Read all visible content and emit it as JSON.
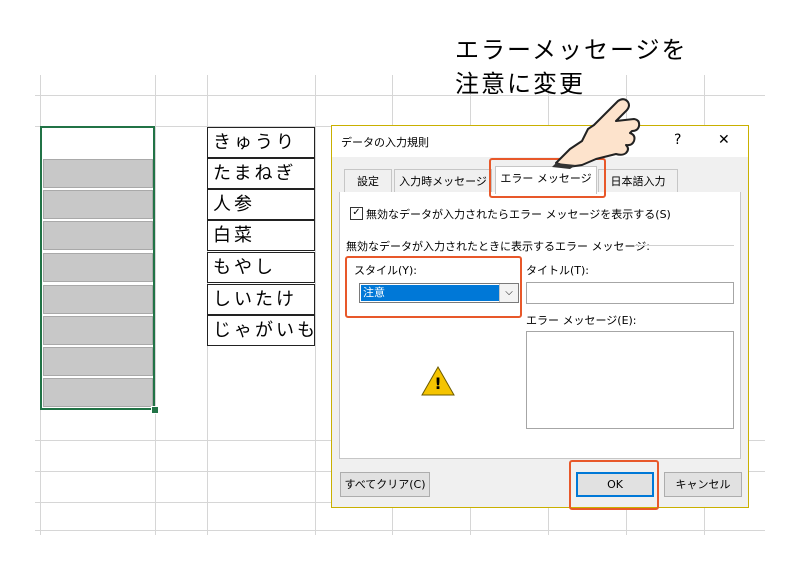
{
  "annotation": {
    "line1": "エラーメッセージを",
    "line2": "注意に変更"
  },
  "vegetables": [
    "きゅうり",
    "たまねぎ",
    "人参",
    "白菜",
    "もやし",
    "しいたけ",
    "じゃがいも"
  ],
  "dialog": {
    "title": "データの入力規則",
    "help_button": "?",
    "close_button": "✕",
    "tabs": [
      "設定",
      "入力時メッセージ",
      "エラー メッセージ",
      "日本語入力"
    ],
    "active_tab": "エラー メッセージ",
    "show_error_checkbox": {
      "label": "無効なデータが入力されたらエラー メッセージを表示する(S)",
      "checked": true,
      "mark": "✓"
    },
    "section_label": "無効なデータが入力されたときに表示するエラー メッセージ:",
    "style": {
      "label": "スタイル(Y):",
      "value": "注意",
      "arrow": "⌵"
    },
    "title_field": {
      "label": "タイトル(T):",
      "value": ""
    },
    "message_field": {
      "label": "エラー メッセージ(E):",
      "value": ""
    },
    "warning_icon": "!",
    "buttons": {
      "clear_all": "すべてクリア(C)",
      "ok": "OK",
      "cancel": "キャンセル"
    }
  },
  "colors": {
    "highlight": "#e8582a",
    "selection": "#0078d7",
    "dialog_border": "#c9b000",
    "excel_green": "#217346",
    "warning_yellow": "#f5c400"
  }
}
